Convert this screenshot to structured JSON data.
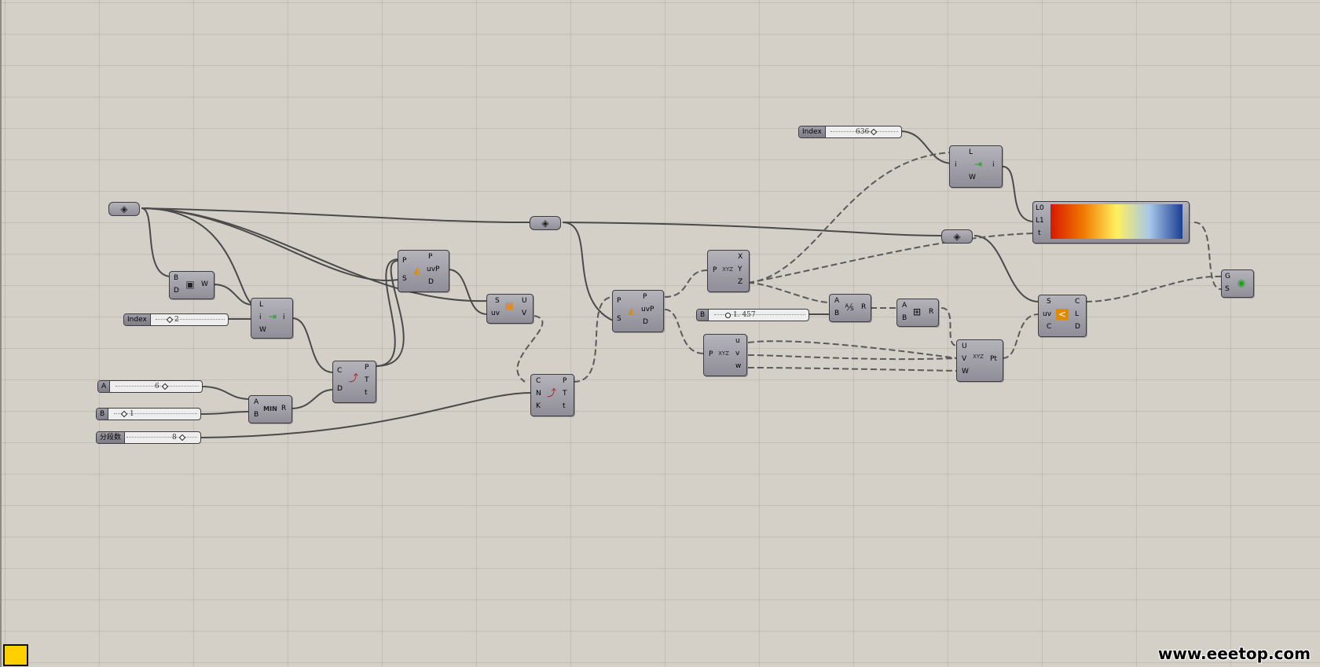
{
  "canvas": {
    "background": "#d4d0c8",
    "grid_color": "#bcb9b1",
    "wire_color": "#4a4a4a"
  },
  "sliders": [
    {
      "id": "index-1",
      "label": "Index",
      "value": "2"
    },
    {
      "id": "a",
      "label": "A",
      "value": "6"
    },
    {
      "id": "b",
      "label": "B",
      "value": "1"
    },
    {
      "id": "segments",
      "label": "分段数",
      "value": "8"
    },
    {
      "id": "b-2",
      "label": "B",
      "value": "1. 457"
    },
    {
      "id": "index-2",
      "label": "Index",
      "value": "636"
    }
  ],
  "components": {
    "box": {
      "inputs": [
        "B",
        "D"
      ],
      "outputs": [
        "W"
      ],
      "icon": "box-icon"
    },
    "list-item-1": {
      "inputs": [
        "L",
        "i",
        "W"
      ],
      "outputs": [
        "i"
      ],
      "icon": "list-item-icon"
    },
    "minimum": {
      "inputs": [
        "A",
        "B"
      ],
      "outputs": [
        "R"
      ],
      "icon_text": "MIN"
    },
    "divide-curve": {
      "inputs": [
        "C",
        "D"
      ],
      "outputs": [
        "P",
        "T",
        "t"
      ],
      "icon": "divide-curve-icon"
    },
    "surface-cp-1": {
      "inputs": [
        "P",
        "S"
      ],
      "outputs": [
        "P",
        "uvP",
        "D"
      ],
      "icon": "surface-closest-point-icon"
    },
    "evaluate-surface": {
      "inputs": [
        "S",
        "uv"
      ],
      "outputs": [
        "U",
        "V"
      ],
      "icon": "evaluate-surface-icon"
    },
    "curve-cp": {
      "inputs": [
        "C",
        "N",
        "K"
      ],
      "outputs": [
        "P",
        "T",
        "t"
      ],
      "icon": "curve-closest-point-icon"
    },
    "surface-cp-2": {
      "inputs": [
        "P",
        "S"
      ],
      "outputs": [
        "P",
        "uvP",
        "D"
      ],
      "icon": "surface-closest-point-icon"
    },
    "deconstruct-xyz": {
      "inputs": [
        "P"
      ],
      "outputs": [
        "X",
        "Y",
        "Z"
      ],
      "icon_text": "XYZ"
    },
    "deconstruct-uvw": {
      "inputs": [
        "P"
      ],
      "outputs": [
        "u",
        "v",
        "w"
      ],
      "icon_text": "XYZ"
    },
    "division": {
      "inputs": [
        "A",
        "B"
      ],
      "outputs": [
        "R"
      ],
      "icon": "division-icon"
    },
    "addition": {
      "inputs": [
        "A",
        "B"
      ],
      "outputs": [
        "R"
      ],
      "icon": "addition-icon"
    },
    "construct-point": {
      "inputs": [
        "U",
        "V",
        "W"
      ],
      "outputs": [
        "Pt"
      ],
      "icon_text": "XYZ"
    },
    "list-item-2": {
      "inputs": [
        "L",
        "i",
        "W"
      ],
      "outputs": [
        "i"
      ],
      "icon": "list-item-icon"
    },
    "gradient": {
      "inputs": [
        "L0",
        "L1",
        "t"
      ],
      "colors": [
        "#d81800",
        "#f07a00",
        "#fff060",
        "#a6c8ea",
        "#1c3e92"
      ]
    },
    "evaluate-surface-2": {
      "inputs": [
        "S",
        "uv",
        "C"
      ],
      "outputs": [
        "C",
        "L",
        "D"
      ],
      "icon": "evaluate-surface-icon"
    },
    "custom-preview": {
      "inputs": [
        "G",
        "S"
      ],
      "icon": "preview-icon"
    }
  },
  "watermark": "www.eeetop.com"
}
